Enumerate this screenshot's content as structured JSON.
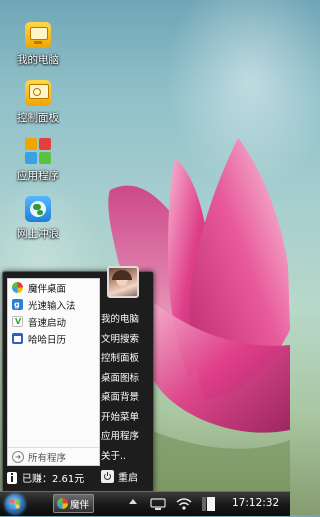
{
  "desktop": {
    "icons": [
      {
        "label": "我的电脑",
        "icon": "computer-icon"
      },
      {
        "label": "控制面板",
        "icon": "control-panel-icon"
      },
      {
        "label": "应用程序",
        "icon": "apps-icon"
      },
      {
        "label": "网上冲浪",
        "icon": "globe-icon"
      }
    ]
  },
  "start_menu": {
    "apps": [
      {
        "label": "魔伴桌面",
        "icon": "pinwheel-icon"
      },
      {
        "label": "光速输入法",
        "icon": "input-method-icon"
      },
      {
        "label": "音速启动",
        "icon": "launcher-icon"
      },
      {
        "label": "哈哈日历",
        "icon": "calendar-icon"
      }
    ],
    "all_programs": "所有程序",
    "links": [
      "我的电脑",
      "文明搜索",
      "控制面板",
      "桌面图标",
      "桌面背景",
      "开始菜单",
      "应用程序",
      "关于.."
    ],
    "earnings": "已赚：2.61元",
    "restart": "重启"
  },
  "taskbar": {
    "task_label": "魔伴",
    "clock": "17:12:32"
  },
  "colors": {
    "taskbar": "#1a1a1a",
    "menu_bg": "#1d1d1d",
    "lotus_pink": "#e0408a"
  }
}
